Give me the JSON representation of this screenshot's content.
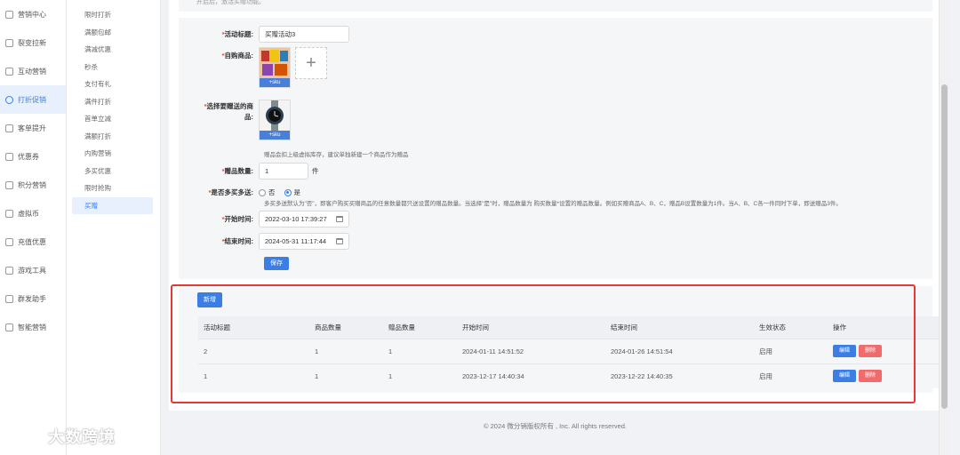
{
  "sidebar": {
    "items": [
      {
        "label": "营销中心",
        "icon": "check-square-icon"
      },
      {
        "label": "裂变拉新",
        "icon": "settings-icon"
      },
      {
        "label": "互动营销",
        "icon": "home-icon"
      },
      {
        "label": "打折促销",
        "icon": "discount-icon"
      },
      {
        "label": "客单提升",
        "icon": "doc-icon"
      },
      {
        "label": "优惠券",
        "icon": "coupon-icon"
      },
      {
        "label": "积分营销",
        "icon": "points-icon"
      },
      {
        "label": "虚拟币",
        "icon": "coin-icon"
      },
      {
        "label": "充值优惠",
        "icon": "recharge-icon"
      },
      {
        "label": "游戏工具",
        "icon": "game-icon"
      },
      {
        "label": "群发助手",
        "icon": "broadcast-icon"
      },
      {
        "label": "智能营销",
        "icon": "smart-icon"
      }
    ]
  },
  "submenu": {
    "items": [
      "限时打折",
      "满额包邮",
      "满减优惠",
      "秒杀",
      "支付有礼",
      "满件打折",
      "首单立减",
      "满额打折",
      "内购营销",
      "多买优惠",
      "限时抢购",
      "买赠"
    ]
  },
  "top_tip": "开启后，激活买赠功能。",
  "form": {
    "title_label": "活动标题:",
    "title_value": "买赠活动3",
    "self_product_label": "自购商品:",
    "sku_label": "+sku",
    "gift_label_line1": "选择要赠送的商",
    "gift_label_line2": "品:",
    "gift_hint": "赠品会扣上级虚拟库存，建议单独新建一个商品作为赠品",
    "gift_qty_label": "赠品数量:",
    "gift_qty_value": "1",
    "gift_qty_unit": "件",
    "multi_label": "是否多买多送:",
    "radio_no": "否",
    "radio_yes": "是",
    "multi_hint": "多买多送默认为\"否\"，即客户购买买赠商品的任意数量都只送设置的赠品数量。当选择\"是\"时，赠品数量为 购买数量*设置的赠品数量。例如买赠商品A、B、C，赠品B设置数量为1件。当A、B、C各一件同时下单，即送赠品3件。",
    "start_label": "开始时间:",
    "start_value": "2022-03-10 17:39:27",
    "end_label": "结束时间:",
    "end_value": "2024-05-31 11:17:44",
    "save_label": "保存",
    "required_mark": "*"
  },
  "table": {
    "new_label": "新增",
    "columns": [
      "活动标题",
      "商品数量",
      "赠品数量",
      "开始时间",
      "结束时间",
      "生效状态",
      "操作"
    ],
    "rows": [
      {
        "title": "2",
        "product_qty": "1",
        "gift_qty": "1",
        "start": "2024-01-11 14:51:52",
        "end": "2024-01-26 14:51:54",
        "status": "启用"
      },
      {
        "title": "1",
        "product_qty": "1",
        "gift_qty": "1",
        "start": "2023-12-17 14:40:34",
        "end": "2023-12-22 14:40:35",
        "status": "启用"
      }
    ],
    "edit_label": "编辑",
    "delete_label": "删除"
  },
  "footer": "© 2024 微分销版权所有 , Inc. All rights reserved.",
  "watermark": "大数跨境",
  "colors": {
    "accent": "#3b7fe5",
    "danger": "#f06b6b",
    "highlight_frame": "#e53935"
  }
}
